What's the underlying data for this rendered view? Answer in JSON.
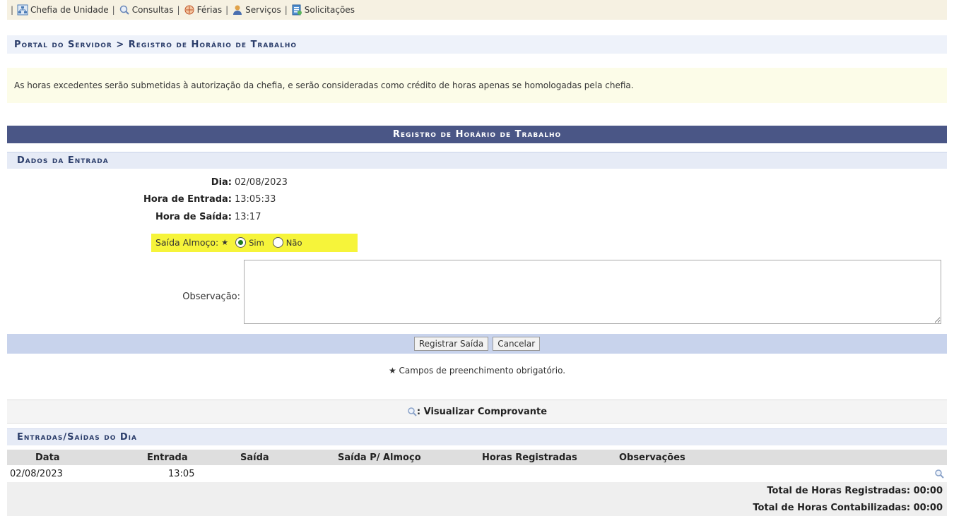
{
  "menu": {
    "items": [
      {
        "label": "Chefia de Unidade",
        "icon": "org-chart-icon"
      },
      {
        "label": "Consultas",
        "icon": "search-icon"
      },
      {
        "label": "Férias",
        "icon": "vacation-icon"
      },
      {
        "label": "Serviços",
        "icon": "person-icon"
      },
      {
        "label": "Solicitações",
        "icon": "document-icon"
      }
    ],
    "separator": "|"
  },
  "breadcrumb": "Portal do Servidor > Registro de Horário de Trabalho",
  "notice": "As horas excedentes serão submetidas à autorização da chefia, e serão consideradas como crédito de horas apenas se homologadas pela chefia.",
  "form": {
    "title": "Registro de Horário de Trabalho",
    "section_title": "Dados da Entrada",
    "dia_label": "Dia:",
    "dia_value": "02/08/2023",
    "entrada_label": "Hora de Entrada:",
    "entrada_value": "13:05:33",
    "saida_label": "Hora de Saída:",
    "saida_value": "13:17",
    "almoco_label": "Saída Almoço:",
    "required_mark": "★",
    "almoco_sim": "Sim",
    "almoco_nao": "Não",
    "almoco_selected": "Sim",
    "observacao_label": "Observação:",
    "observacao_value": "",
    "submit_label": "Registrar Saída",
    "cancel_label": "Cancelar",
    "required_note": "★ Campos de preenchimento obrigatório.",
    "legend_text": ": Visualizar Comprovante"
  },
  "log": {
    "section_title": "Entradas/Saídas do Dia",
    "columns": [
      "Data",
      "Entrada",
      "Saída",
      "Saída P/ Almoço",
      "Horas Registradas",
      "Observações"
    ],
    "rows": [
      {
        "data": "02/08/2023",
        "entrada": "13:05",
        "saida": "",
        "almoco": "",
        "horas": "",
        "obs": ""
      }
    ],
    "total_registradas": "Total de Horas Registradas: 00:00",
    "total_contabilizadas": "Total de Horas Contabilizadas: 00:00"
  },
  "colors": {
    "header_bg": "#4a5686",
    "section_bg": "#e6ebf6",
    "highlight": "#f6f43a",
    "button_bar": "#c8d3ec"
  }
}
